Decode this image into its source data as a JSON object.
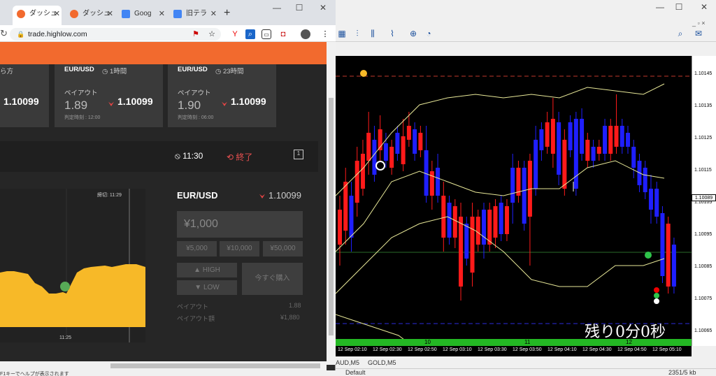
{
  "mt4": {
    "labels": {
      "p1": "1.10145",
      "p2": "1.10135",
      "p3": "1.10125",
      "p4": "1.10115",
      "p5": "1.10105",
      "p6": "1.10095",
      "p7": "1.10085",
      "p8": "1.10075",
      "p9": "1.10065"
    },
    "current": "1.10089",
    "overlay_text": "残り0分0秒",
    "time_ticks": [
      "12 Sep 02:10",
      "12 Sep 02:30",
      "12 Sep 02:50",
      "12 Sep 03:10",
      "12 Sep 03:30",
      "12 Sep 03:50",
      "12 Sep 04:10",
      "12 Sep 04:30",
      "12 Sep 04:50",
      "12 Sep 05:10"
    ],
    "day_labels": [
      "10",
      "11",
      "12"
    ],
    "tabs": [
      "AUD,M5",
      "GOLD,M5"
    ],
    "status_help": "F1キーでヘルプが表示されます",
    "status_default": "Default",
    "status_traffic": "2351/5 kb"
  },
  "browser": {
    "tabs": [
      "ダッシュ",
      "ダッシュ",
      "Goog",
      "旧テラ"
    ],
    "new_tab": "+",
    "url": "trade.highlow.com"
  },
  "cards": [
    {
      "pair": "EUR/USD",
      "time": "1時間",
      "payout_label": "ペイアウト",
      "payout": "1.89",
      "rate": "1.10099",
      "expiry": "判定時刻 : 12:00"
    },
    {
      "pair": "EUR/USD",
      "time": "23時間",
      "payout_label": "ペイアウト",
      "payout": "1.90",
      "rate": "1.10099",
      "expiry": "判定時刻 : 06:00"
    }
  ],
  "left_partial": {
    "prefix": "ら方",
    "rate": "1.10099"
  },
  "timer": {
    "clock": "11:30",
    "status": "終了"
  },
  "mini": {
    "deadline": "締切: 11:29",
    "tick": "11:25"
  },
  "trade": {
    "pair": "EUR/USD",
    "rate": "1.10099",
    "amount_placeholder": "¥1,000",
    "quick": [
      "¥5,000",
      "¥10,000",
      "¥50,000"
    ],
    "high": "HIGH",
    "low": "LOW",
    "buy_now": "今すぐ購入",
    "payout_label": "ペイアウト",
    "payout": "1.88",
    "payout_amt_label": "ペイアウト額",
    "payout_amt": "¥1,880"
  },
  "colors": {
    "bull": "#ff1a1a",
    "bear": "#1f1fff",
    "band": "#e8e898",
    "orange": "#f26a2e",
    "yellow": "#f7b928"
  }
}
